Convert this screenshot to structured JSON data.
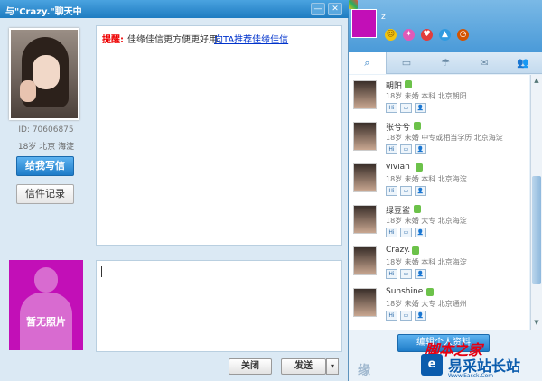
{
  "window": {
    "title": "与\"Crazy.\"聊天中",
    "minimize": "—",
    "close": "✕"
  },
  "profile": {
    "id": "ID: 70606875",
    "meta": "18岁  北京  海淀",
    "write_button": "给我写信",
    "history_button": "信件记录"
  },
  "messages": {
    "tip_label": "提醒:",
    "tip_text": "佳缘佳信更方便更好用。",
    "tip_link": "向TA推荐佳缘佳信"
  },
  "my_avatar": {
    "placeholder": "暂无照片"
  },
  "actions": {
    "close_label": "关闭",
    "send_label": "发送",
    "dropdown": "▾"
  },
  "side_header": {
    "name": "z"
  },
  "tabs": [
    {
      "icon": "search-icon",
      "glyph": "⌕"
    },
    {
      "icon": "chat-icon",
      "glyph": "▭"
    },
    {
      "icon": "umbrella-icon",
      "glyph": "☂"
    },
    {
      "icon": "mail-icon",
      "glyph": "✉"
    },
    {
      "icon": "contacts-icon",
      "glyph": "👥"
    }
  ],
  "users": [
    {
      "name": "朝阳",
      "info": "18岁  未婚  本科  北京朝阳"
    },
    {
      "name": "张兮兮",
      "info": "18岁  未婚  中专或相当学历  北京海淀"
    },
    {
      "name": "vivian",
      "info": "18岁  未婚  本科  北京海淀"
    },
    {
      "name": "绿豆鲨",
      "info": "18岁  未婚  大专  北京海淀"
    },
    {
      "name": "Crazy.",
      "info": "18岁  未婚  本科  北京海淀"
    },
    {
      "name": "Sunshine",
      "info": "18岁  未婚  大专  北京通州"
    }
  ],
  "user_actions": {
    "hi": "Hi",
    "msg": "▭",
    "profile": "👤"
  },
  "scrollbar": {
    "up": "▲",
    "down": "▼"
  },
  "footer": {
    "edit_button": "编辑个人资料",
    "logo": "缘"
  },
  "watermark": {
    "top": "脚本之家",
    "logo": "e",
    "text": "易采站长站",
    "url": "Www.Easck.Com"
  }
}
